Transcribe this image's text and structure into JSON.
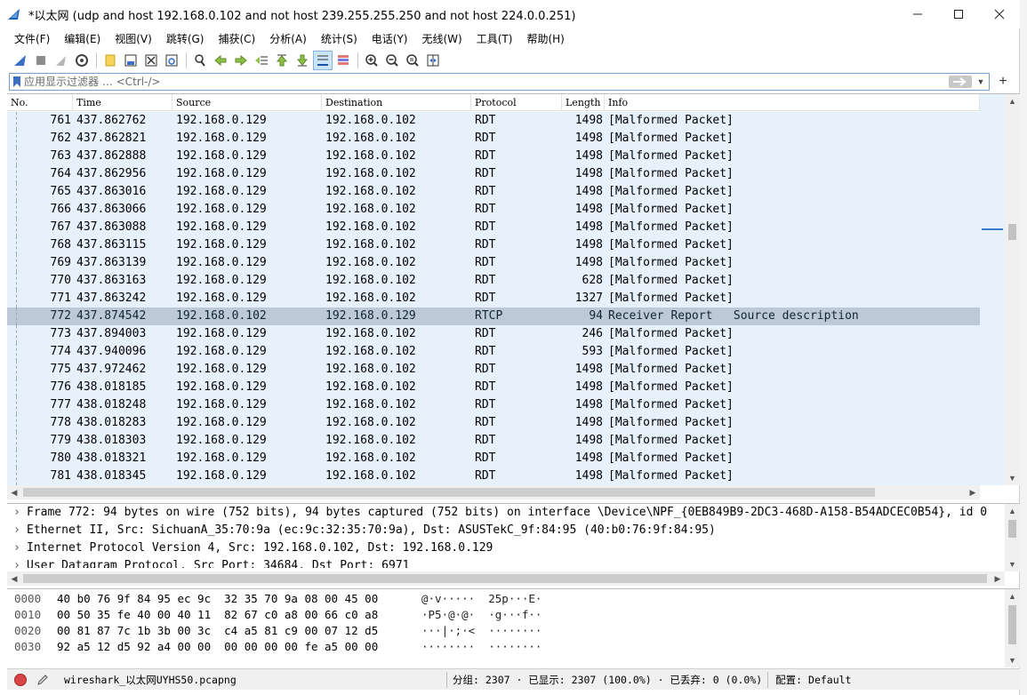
{
  "window": {
    "title": "*以太网 (udp and host 192.168.0.102 and not host 239.255.255.250 and not host 224.0.0.251)"
  },
  "menu": [
    "文件(F)",
    "编辑(E)",
    "视图(V)",
    "跳转(G)",
    "捕获(C)",
    "分析(A)",
    "统计(S)",
    "电话(Y)",
    "无线(W)",
    "工具(T)",
    "帮助(H)"
  ],
  "filter": {
    "placeholder": "应用显示过滤器 … <Ctrl-/>",
    "value": ""
  },
  "packet_list": {
    "columns": [
      "No.",
      "Time",
      "Source",
      "Destination",
      "Protocol",
      "Length",
      "Info"
    ],
    "rows": [
      {
        "no": "761",
        "time": "437.862762",
        "src": "192.168.0.129",
        "dst": "192.168.0.102",
        "proto": "RDT",
        "len": "1498",
        "info": "[Malformed Packet]"
      },
      {
        "no": "762",
        "time": "437.862821",
        "src": "192.168.0.129",
        "dst": "192.168.0.102",
        "proto": "RDT",
        "len": "1498",
        "info": "[Malformed Packet]"
      },
      {
        "no": "763",
        "time": "437.862888",
        "src": "192.168.0.129",
        "dst": "192.168.0.102",
        "proto": "RDT",
        "len": "1498",
        "info": "[Malformed Packet]"
      },
      {
        "no": "764",
        "time": "437.862956",
        "src": "192.168.0.129",
        "dst": "192.168.0.102",
        "proto": "RDT",
        "len": "1498",
        "info": "[Malformed Packet]"
      },
      {
        "no": "765",
        "time": "437.863016",
        "src": "192.168.0.129",
        "dst": "192.168.0.102",
        "proto": "RDT",
        "len": "1498",
        "info": "[Malformed Packet]"
      },
      {
        "no": "766",
        "time": "437.863066",
        "src": "192.168.0.129",
        "dst": "192.168.0.102",
        "proto": "RDT",
        "len": "1498",
        "info": "[Malformed Packet]"
      },
      {
        "no": "767",
        "time": "437.863088",
        "src": "192.168.0.129",
        "dst": "192.168.0.102",
        "proto": "RDT",
        "len": "1498",
        "info": "[Malformed Packet]"
      },
      {
        "no": "768",
        "time": "437.863115",
        "src": "192.168.0.129",
        "dst": "192.168.0.102",
        "proto": "RDT",
        "len": "1498",
        "info": "[Malformed Packet]"
      },
      {
        "no": "769",
        "time": "437.863139",
        "src": "192.168.0.129",
        "dst": "192.168.0.102",
        "proto": "RDT",
        "len": "1498",
        "info": "[Malformed Packet]"
      },
      {
        "no": "770",
        "time": "437.863163",
        "src": "192.168.0.129",
        "dst": "192.168.0.102",
        "proto": "RDT",
        "len": "628",
        "info": "[Malformed Packet]"
      },
      {
        "no": "771",
        "time": "437.863242",
        "src": "192.168.0.129",
        "dst": "192.168.0.102",
        "proto": "RDT",
        "len": "1327",
        "info": "[Malformed Packet]"
      },
      {
        "no": "772",
        "time": "437.874542",
        "src": "192.168.0.102",
        "dst": "192.168.0.129",
        "proto": "RTCP",
        "len": "94",
        "info": "Receiver Report   Source description",
        "selected": true
      },
      {
        "no": "773",
        "time": "437.894003",
        "src": "192.168.0.129",
        "dst": "192.168.0.102",
        "proto": "RDT",
        "len": "246",
        "info": "[Malformed Packet]"
      },
      {
        "no": "774",
        "time": "437.940096",
        "src": "192.168.0.129",
        "dst": "192.168.0.102",
        "proto": "RDT",
        "len": "593",
        "info": "[Malformed Packet]"
      },
      {
        "no": "775",
        "time": "437.972462",
        "src": "192.168.0.129",
        "dst": "192.168.0.102",
        "proto": "RDT",
        "len": "1498",
        "info": "[Malformed Packet]"
      },
      {
        "no": "776",
        "time": "438.018185",
        "src": "192.168.0.129",
        "dst": "192.168.0.102",
        "proto": "RDT",
        "len": "1498",
        "info": "[Malformed Packet]"
      },
      {
        "no": "777",
        "time": "438.018248",
        "src": "192.168.0.129",
        "dst": "192.168.0.102",
        "proto": "RDT",
        "len": "1498",
        "info": "[Malformed Packet]"
      },
      {
        "no": "778",
        "time": "438.018283",
        "src": "192.168.0.129",
        "dst": "192.168.0.102",
        "proto": "RDT",
        "len": "1498",
        "info": "[Malformed Packet]"
      },
      {
        "no": "779",
        "time": "438.018303",
        "src": "192.168.0.129",
        "dst": "192.168.0.102",
        "proto": "RDT",
        "len": "1498",
        "info": "[Malformed Packet]"
      },
      {
        "no": "780",
        "time": "438.018321",
        "src": "192.168.0.129",
        "dst": "192.168.0.102",
        "proto": "RDT",
        "len": "1498",
        "info": "[Malformed Packet]"
      },
      {
        "no": "781",
        "time": "438.018345",
        "src": "192.168.0.129",
        "dst": "192.168.0.102",
        "proto": "RDT",
        "len": "1498",
        "info": "[Malformed Packet]"
      }
    ]
  },
  "details": [
    "Frame 772: 94 bytes on wire (752 bits), 94 bytes captured (752 bits) on interface \\Device\\NPF_{0EB849B9-2DC3-468D-A158-B54ADCEC0B54}, id 0",
    "Ethernet II, Src: SichuanA_35:70:9a (ec:9c:32:35:70:9a), Dst: ASUSTekC_9f:84:95 (40:b0:76:9f:84:95)",
    "Internet Protocol Version 4, Src: 192.168.0.102, Dst: 192.168.0.129",
    "User Datagram Protocol, Src Port: 34684, Dst Port: 6971"
  ],
  "bytes": [
    {
      "offset": "0000",
      "hex": "40 b0 76 9f 84 95 ec 9c  32 35 70 9a 08 00 45 00",
      "ascii": "@·v·····  25p···E·"
    },
    {
      "offset": "0010",
      "hex": "00 50 35 fe 40 00 40 11  82 67 c0 a8 00 66 c0 a8",
      "ascii": "·P5·@·@·  ·g···f··"
    },
    {
      "offset": "0020",
      "hex": "00 81 87 7c 1b 3b 00 3c  c4 a5 81 c9 00 07 12 d5",
      "ascii": "···|·;·<  ········"
    },
    {
      "offset": "0030",
      "hex": "92 a5 12 d5 92 a4 00 00  00 00 00 00 fe a5 00 00",
      "ascii": "········  ········"
    }
  ],
  "status": {
    "file": "wireshark_以太网UYHS50.pcapng",
    "stats": "分组: 2307 · 已显示: 2307 (100.0%) · 已丢弃: 0 (0.0%)",
    "profile": "配置: Default"
  },
  "colors": {
    "row_bg": "#e7f1fc",
    "selected_row_bg": "#bdc9d6",
    "accent": "#3a7bc8"
  }
}
